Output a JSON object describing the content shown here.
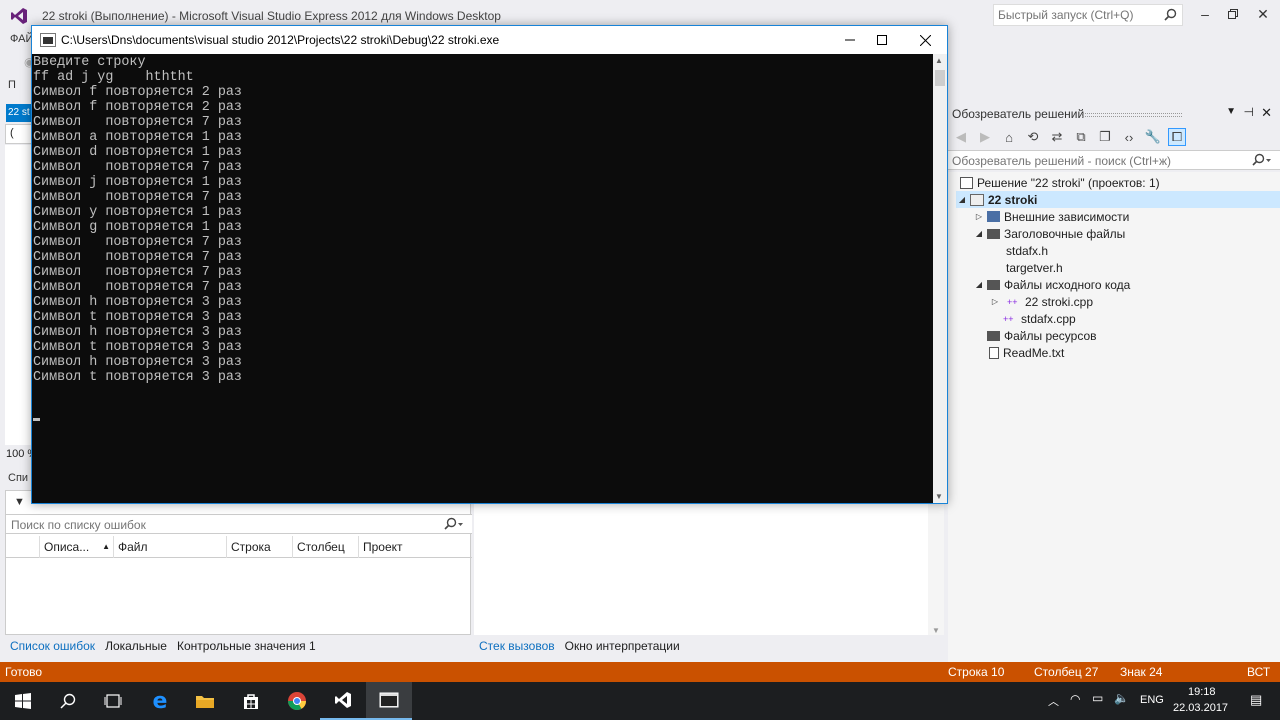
{
  "vs": {
    "title": "22 stroki (Выполнение) - Microsoft Visual Studio Express 2012 для Windows Desktop",
    "quick_launch_placeholder": "Быстрый запуск (Ctrl+Q)",
    "menu_fragment": "ФАЙ",
    "left_fragment": "П",
    "tab_fragment": "22 st",
    "left_field_fragment": "(",
    "zoom": "100 %",
    "errors_label_fragment": "Спи"
  },
  "errors_panel": {
    "search_placeholder": "Поиск по списку ошибок",
    "columns": [
      "",
      "Описа...",
      "Файл",
      "Строка",
      "Столбец",
      "Проект"
    ]
  },
  "bottom_tabs_left": [
    "Список ошибок",
    "Локальные",
    "Контрольные значения 1"
  ],
  "bottom_tabs_right": [
    "Стек вызовов",
    "Окно интерпретации"
  ],
  "solution_explorer": {
    "title": "Обозреватель решений",
    "search_placeholder": "Обозреватель решений - поиск (Ctrl+ж)",
    "items": [
      {
        "label": "Решение \"22 stroki\"  (проектов: 1)",
        "icon": "solution-icon",
        "expander": ""
      },
      {
        "label": "22 stroki",
        "icon": "project-icon",
        "expander": "◢"
      },
      {
        "label": "Внешние зависимости",
        "icon": "dependencies-icon",
        "expander": "▷"
      },
      {
        "label": "Заголовочные файлы",
        "icon": "folder-icon",
        "expander": "◢"
      },
      {
        "label": "stdafx.h",
        "icon": "header-file-icon",
        "expander": ""
      },
      {
        "label": "targetver.h",
        "icon": "header-file-icon",
        "expander": ""
      },
      {
        "label": "Файлы исходного кода",
        "icon": "folder-icon",
        "expander": "◢"
      },
      {
        "label": "22 stroki.cpp",
        "icon": "cpp-file-icon",
        "expander": "▷"
      },
      {
        "label": "stdafx.cpp",
        "icon": "cpp-file-icon",
        "expander": ""
      },
      {
        "label": "Файлы ресурсов",
        "icon": "folder-icon",
        "expander": ""
      },
      {
        "label": "ReadMe.txt",
        "icon": "text-file-icon",
        "expander": ""
      }
    ]
  },
  "statusbar": {
    "ready": "Готово",
    "line": "Строка 10",
    "column": "Столбец 27",
    "char": "Знак 24",
    "mode": "ВСТ"
  },
  "console": {
    "title": "C:\\Users\\Dns\\documents\\visual studio 2012\\Projects\\22 stroki\\Debug\\22 stroki.exe",
    "lines": [
      "Введите строку",
      "ff ad j yg    hththt",
      "Символ f повторяется 2 раз",
      "Символ f повторяется 2 раз",
      "Символ   повторяется 7 раз",
      "Символ a повторяется 1 раз",
      "Символ d повторяется 1 раз",
      "Символ   повторяется 7 раз",
      "Символ j повторяется 1 раз",
      "Символ   повторяется 7 раз",
      "Символ y повторяется 1 раз",
      "Символ g повторяется 1 раз",
      "Символ   повторяется 7 раз",
      "Символ   повторяется 7 раз",
      "Символ   повторяется 7 раз",
      "Символ   повторяется 7 раз",
      "Символ h повторяется 3 раз",
      "Символ t повторяется 3 раз",
      "Символ h повторяется 3 раз",
      "Символ t повторяется 3 раз",
      "Символ h повторяется 3 раз",
      "Символ t повторяется 3 раз"
    ]
  },
  "tray": {
    "language": "ENG",
    "time": "19:18",
    "date": "22.03.2017"
  },
  "taskbar_icons": [
    "start-icon",
    "search-icon",
    "task-view-icon",
    "edge-icon",
    "file-explorer-icon",
    "store-icon",
    "chrome-icon",
    "visual-studio-icon",
    "console-app-icon"
  ],
  "colors": {
    "accent": "#007acc",
    "statusbar": "#ca5100",
    "console_bg": "#0c0c0c",
    "console_fg": "#c0c0c0"
  }
}
